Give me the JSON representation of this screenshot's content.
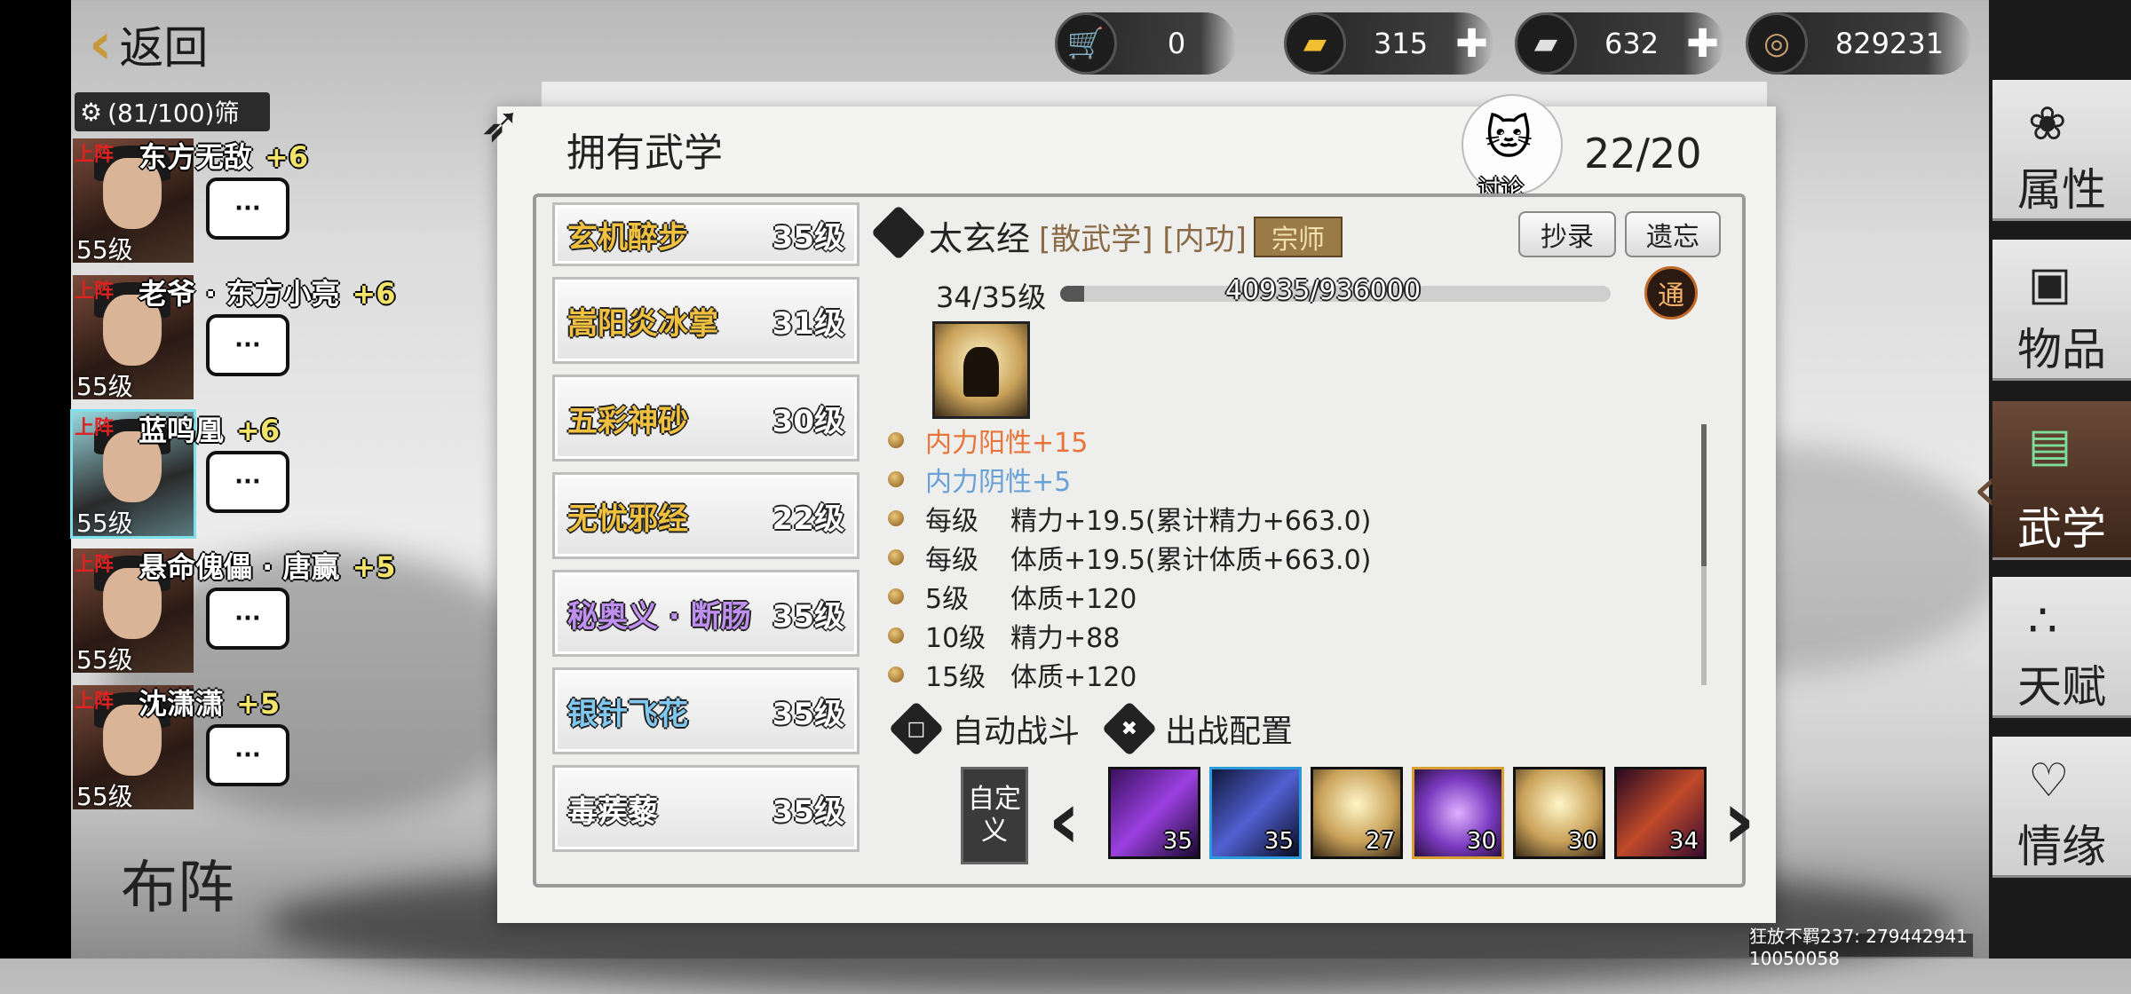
{
  "top": {
    "back_label": "返回",
    "currencies": [
      {
        "icon": "tribute-cart-icon",
        "value": "0",
        "has_plus": false
      },
      {
        "icon": "gold-ingot-icon",
        "value": "315",
        "has_plus": true
      },
      {
        "icon": "silver-ingot-icon",
        "value": "632",
        "has_plus": true
      },
      {
        "icon": "copper-coin-icon",
        "value": "829231",
        "has_plus": false
      }
    ]
  },
  "roster": {
    "filter_label": "(81/100)筛",
    "heroes": [
      {
        "tag": "上阵",
        "name": "东方无敌",
        "plus": "+6",
        "level": "55级"
      },
      {
        "tag": "上阵",
        "name": "老爷 · 东方小亮",
        "plus": "+6",
        "level": "55级"
      },
      {
        "tag": "上阵",
        "name": "蓝鸣凰",
        "plus": "+6",
        "level": "55级",
        "selected": true
      },
      {
        "tag": "上阵",
        "name": "悬命傀儡 · 唐赢",
        "plus": "+5",
        "level": "55级"
      },
      {
        "tag": "上阵",
        "name": "沈潇潇",
        "plus": "+5",
        "level": "55级"
      }
    ],
    "chat_label": "···",
    "formation_label": "布阵"
  },
  "panel": {
    "title": "拥有武学",
    "count": "22/20",
    "discuss_label": "讨论",
    "skills": [
      {
        "name": "玄机醉步",
        "level": "35级",
        "color": "#f0c040"
      },
      {
        "name": "嵩阳炎冰掌",
        "level": "31级",
        "color": "#f0c040"
      },
      {
        "name": "五彩神砂",
        "level": "30级",
        "color": "#f0c040"
      },
      {
        "name": "无忧邪经",
        "level": "22级",
        "color": "#f0c040"
      },
      {
        "name": "秘奥义 · 断肠",
        "level": "35级",
        "color": "#c090f0"
      },
      {
        "name": "银针飞花",
        "level": "35级",
        "color": "#80c8f0"
      },
      {
        "name": "毒蒺藜",
        "level": "35级",
        "color": "#ffffff"
      }
    ],
    "detail": {
      "name": "太玄经",
      "tags": "[散武学] [内功]",
      "rank": "宗师",
      "copy_label": "抄录",
      "forget_label": "遗忘",
      "level": "34/35级",
      "exp_text": "40935/936000",
      "exp_progress": 0.0437,
      "tong_label": "通",
      "attrs": [
        {
          "pre": "",
          "text": "内力阳性+15",
          "color": "#e8743a"
        },
        {
          "pre": "",
          "text": "内力阴性+5",
          "color": "#6aa0d8"
        },
        {
          "pre": "每级",
          "text": "精力+19.5(累计精力+663.0)",
          "color": "#222222"
        },
        {
          "pre": "每级",
          "text": "体质+19.5(累计体质+663.0)",
          "color": "#222222"
        },
        {
          "pre": "5级",
          "text": "体质+120",
          "color": "#222222"
        },
        {
          "pre": "10级",
          "text": "精力+88",
          "color": "#222222"
        },
        {
          "pre": "15级",
          "text": "体质+120",
          "color": "#222222"
        }
      ]
    },
    "auto_battle_label": "自动战斗",
    "battle_config_label": "出战配置",
    "custom_label": "自定义",
    "slots": [
      {
        "icon": "purple-spear-icon",
        "level": "35",
        "border": "#111"
      },
      {
        "icon": "purple-claw-icon",
        "level": "35",
        "border": "#2a9ad8"
      },
      {
        "icon": "meditation-icon",
        "level": "27",
        "border": "#111"
      },
      {
        "icon": "purple-flower-icon",
        "level": "30",
        "border": "#d8a030"
      },
      {
        "icon": "meditation-icon",
        "level": "30",
        "border": "#111"
      },
      {
        "icon": "fist-icon",
        "level": "34",
        "border": "#111"
      }
    ]
  },
  "menu": [
    {
      "label": "属性",
      "icon": "attribute-icon",
      "active": false
    },
    {
      "label": "物品",
      "icon": "gift-box-icon",
      "active": false
    },
    {
      "label": "武学",
      "icon": "book-icon",
      "active": true
    },
    {
      "label": "天赋",
      "icon": "talent-tree-icon",
      "active": false
    },
    {
      "label": "情缘",
      "icon": "heart-icon",
      "active": false
    }
  ],
  "watermark": "狂放不羁237: 279442941 10050058"
}
